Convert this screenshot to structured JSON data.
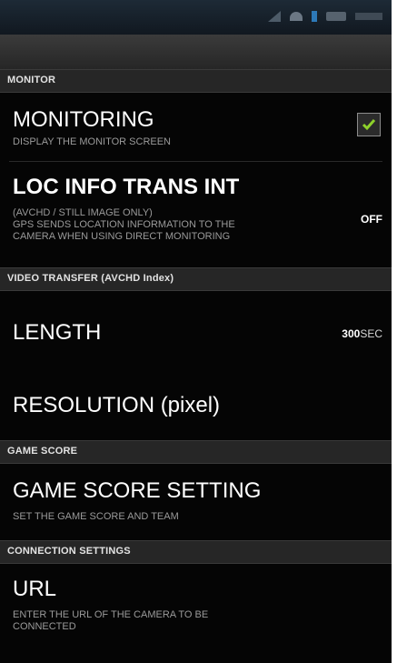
{
  "sections": {
    "monitor": "MONITOR",
    "video_transfer": "VIDEO TRANSFER (AVCHD Index)",
    "game_score": "GAME SCORE",
    "connection": "CONNECTION SETTINGS"
  },
  "monitoring": {
    "title": "MONITORING",
    "subtitle": "DISPLAY THE MONITOR SCREEN",
    "checked": true
  },
  "loc_info": {
    "title": "LOC INFO TRANS INT",
    "subtitle_1": "(AVCHD / STILL IMAGE ONLY)",
    "subtitle_2": "GPS SENDS LOCATION INFORMATION TO THE",
    "subtitle_3": "CAMERA WHEN USING DIRECT MONITORING",
    "value": "OFF"
  },
  "length": {
    "title": "LENGTH",
    "value": "300",
    "unit": "SEC"
  },
  "resolution": {
    "title": "RESOLUTION (pixel)"
  },
  "game_score_setting": {
    "title": "GAME SCORE SETTING",
    "subtitle": "SET THE GAME SCORE AND TEAM"
  },
  "url": {
    "title": "URL",
    "subtitle_1": "ENTER THE URL OF THE CAMERA TO BE",
    "subtitle_2": "CONNECTED"
  },
  "colors": {
    "check": "#8ed12b",
    "background": "#050505",
    "section": "#262626"
  },
  "icons": [
    "signal-icon",
    "wifi-icon",
    "bluetooth-icon",
    "battery-icon",
    "check-icon"
  ]
}
